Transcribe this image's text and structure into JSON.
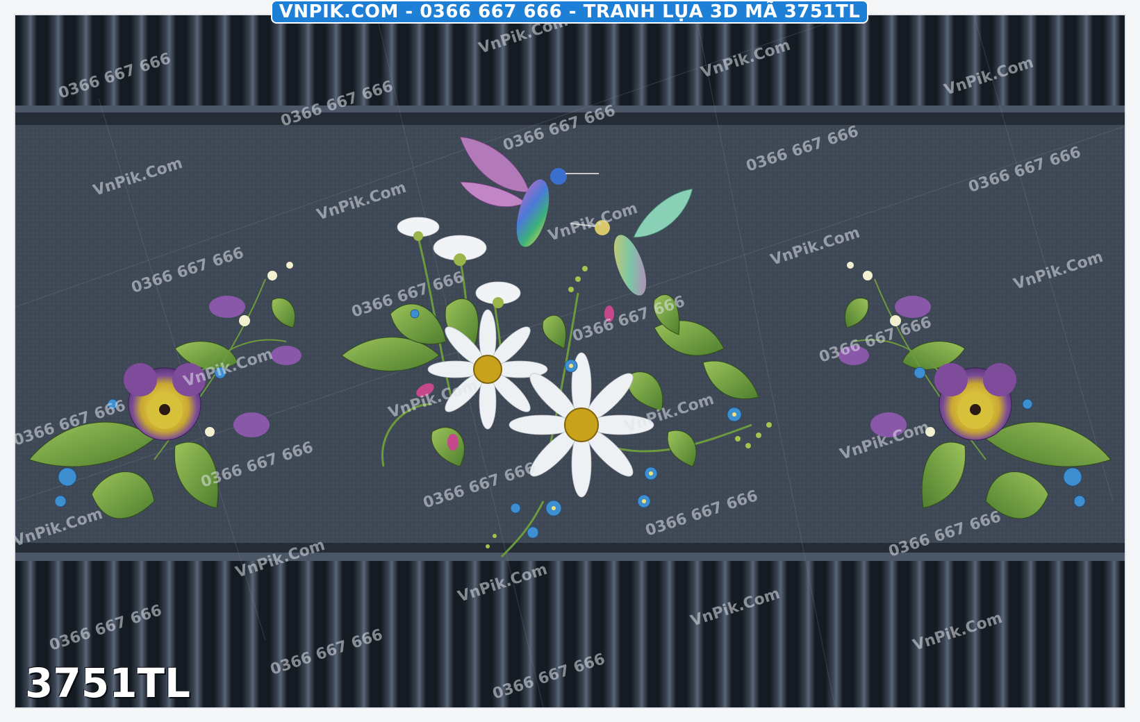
{
  "header": {
    "banner_text": "VNPIK.COM - 0366 667 666 - TRANH LỤA 3D MÃ 3751TL"
  },
  "product_code": "3751TL",
  "watermarks": {
    "site": "VnPik.Com",
    "phone": "0366 667 666"
  },
  "colors": {
    "background": "#3f4856",
    "panel": "#2b323c",
    "slat_dark": "#1a2028",
    "slat_light": "#4a5666",
    "leaf": "#6fa542",
    "daisy": "#eef1f4",
    "daisy_center": "#c9a21c",
    "pansy": "#7e4c9a",
    "pansy_center": "#d8c13a",
    "forget_me_not": "#3e8fd0",
    "banner": "#1e7fd6"
  }
}
